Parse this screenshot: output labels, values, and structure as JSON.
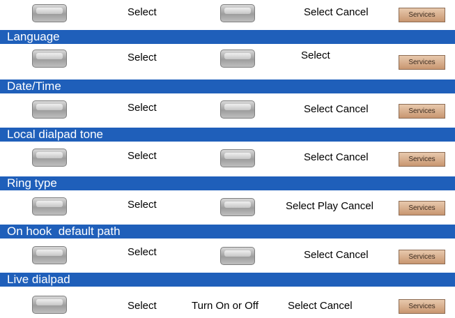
{
  "softkey_rows": [
    {
      "col1": "Select",
      "col2": "",
      "col3": "Select Cancel",
      "services": "Services"
    },
    {
      "col1": "Select",
      "col2": "",
      "col3": "Select",
      "services": "Services"
    },
    {
      "col1": "Select",
      "col2": "",
      "col3": "Select Cancel",
      "services": "Services"
    },
    {
      "col1": "Select",
      "col2": "",
      "col3": "Select Cancel",
      "services": "Services"
    },
    {
      "col1": "Select",
      "col2": "",
      "col3": "Select Play Cancel",
      "services": "Services"
    },
    {
      "col1": "Select",
      "col2": "",
      "col3": "Select Cancel",
      "services": "Services"
    },
    {
      "col1": "Select",
      "col2": "Turn On or Off",
      "col3": "Select Cancel",
      "services": "Services"
    }
  ],
  "section_headers": [
    "Language",
    "Date/Time",
    "Local dialpad tone",
    "Ring type",
    "On hook  default path",
    "Live dialpad"
  ],
  "colors": {
    "header_bg": "#1f5fba",
    "services_bg": "#c89670"
  }
}
